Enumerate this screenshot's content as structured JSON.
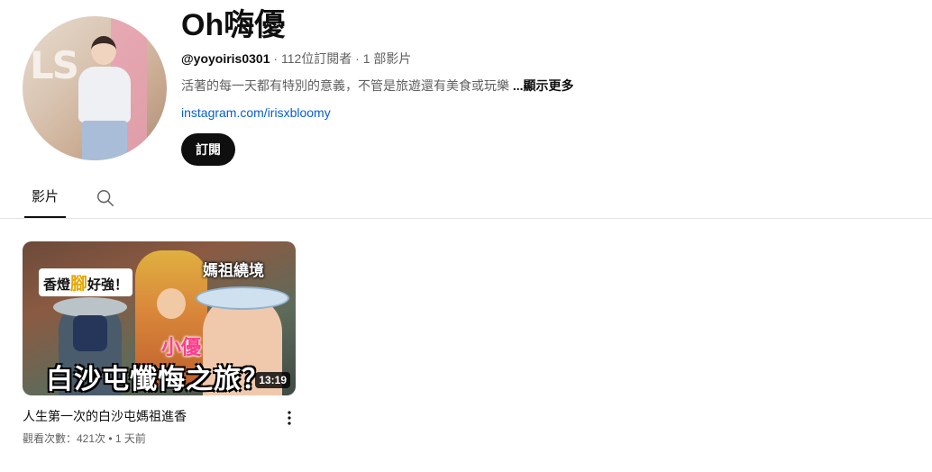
{
  "channel": {
    "name": "Oh嗨優",
    "handle": "@yoyoiris0301",
    "subscribers": "112位訂閱者",
    "video_count": "1 部影片",
    "description": "活著的每一天都有特別的意義，不管是旅遊還有美食或玩樂",
    "show_more": "...顯示更多",
    "link": "instagram.com/irisxbloomy",
    "subscribe_label": "訂閱",
    "avatar_letters": "LS"
  },
  "tabs": [
    {
      "label": "影片",
      "selected": true,
      "icon": "underline-tab"
    },
    {
      "icon": "search-icon"
    }
  ],
  "videos": [
    {
      "title": "人生第一次的白沙屯媽祖進香",
      "views": "觀看次數：421次",
      "age": "1 天前",
      "duration": "13:19",
      "thumb_text": {
        "top_left_a": "香燈",
        "top_left_b": "腳",
        "top_left_c": "好強！",
        "top_right": "媽祖繞境",
        "pink": "小優",
        "big": "白沙屯懺悔之旅？"
      }
    }
  ],
  "colors": {
    "link": "#065fd4",
    "button": "#0f0f0f",
    "muted": "#606060",
    "pink_caption": "#ff3d8b"
  }
}
